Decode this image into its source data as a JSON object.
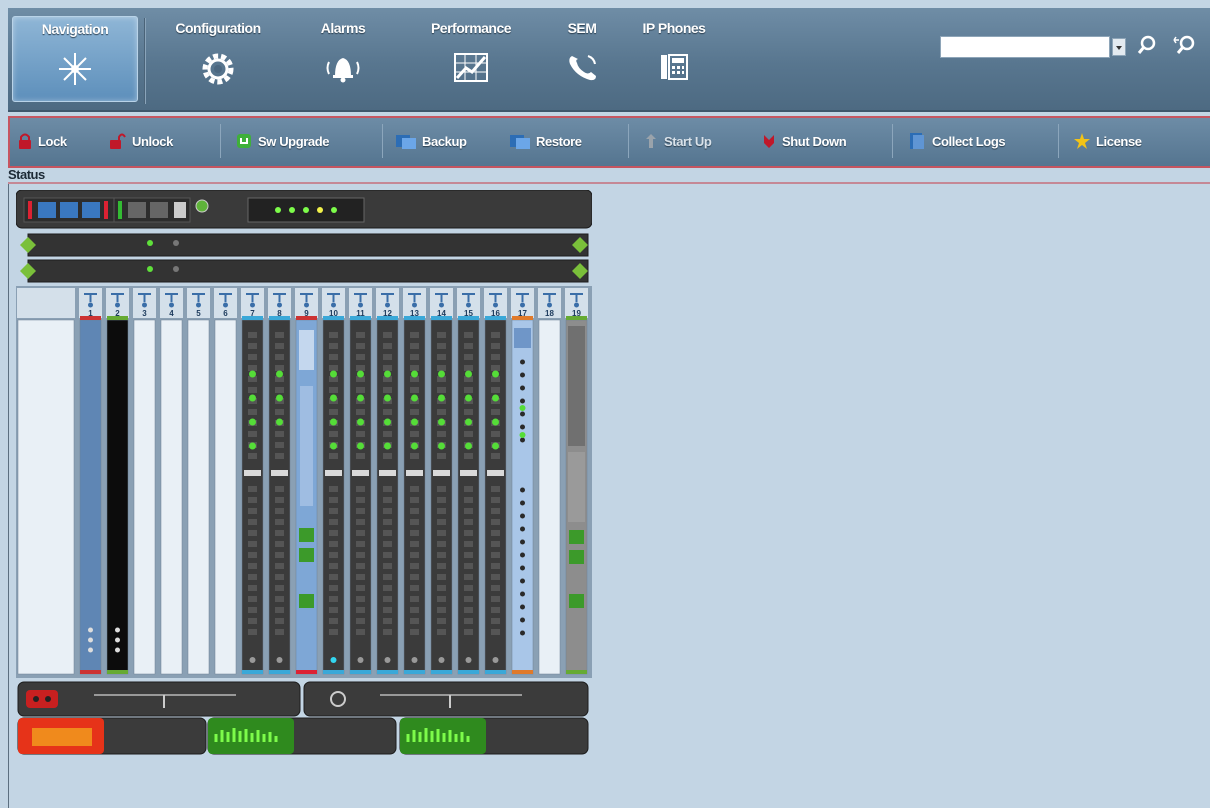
{
  "nav": {
    "tabs": [
      {
        "label": "Navigation",
        "icon": "compass-star-icon",
        "active": true
      },
      {
        "label": "Configuration",
        "icon": "gear-icon",
        "active": false
      },
      {
        "label": "Alarms",
        "icon": "bell-icon",
        "active": false
      },
      {
        "label": "Performance",
        "icon": "chart-icon",
        "active": false
      },
      {
        "label": "SEM",
        "icon": "phone-handset-icon",
        "active": false
      },
      {
        "label": "IP Phones",
        "icon": "desk-phone-icon",
        "active": false
      }
    ],
    "search": {
      "value": "",
      "placeholder": ""
    }
  },
  "toolbar": {
    "buttons": [
      {
        "label": "Lock",
        "icon": "lock-icon",
        "color": "#c0182a"
      },
      {
        "label": "Unlock",
        "icon": "unlock-icon",
        "color": "#c0182a"
      },
      {
        "label": "Sw Upgrade",
        "icon": "upgrade-icon",
        "color": "#3fb03a"
      },
      {
        "label": "Backup",
        "icon": "backup-icon",
        "color": "#2c6db5"
      },
      {
        "label": "Restore",
        "icon": "restore-icon",
        "color": "#2c6db5"
      },
      {
        "label": "Start Up",
        "icon": "startup-icon",
        "color": "#9aa3ab"
      },
      {
        "label": "Shut Down",
        "icon": "shutdown-icon",
        "color": "#c0182a"
      },
      {
        "label": "Collect Logs",
        "icon": "logs-icon",
        "color": "#2c6db5"
      },
      {
        "label": "License",
        "icon": "star-icon",
        "color": "#f2c316"
      }
    ]
  },
  "status": {
    "label": "Status"
  },
  "chassis": {
    "slots": [
      "1",
      "2",
      "3",
      "4",
      "5",
      "6",
      "7",
      "8",
      "9",
      "10",
      "11",
      "12",
      "13",
      "14",
      "15",
      "16",
      "17",
      "18",
      "19"
    ],
    "top_led_colors": [
      "#7dfc4a",
      "#7dfc4a",
      "#7dfc4a",
      "#f1f14a",
      "#7dfc4a"
    ]
  },
  "colors": {
    "accent_red": "#c65560",
    "led_green": "#6ef04a",
    "alarm_orange": "#f08a1c",
    "background": "#c3d5e4"
  }
}
